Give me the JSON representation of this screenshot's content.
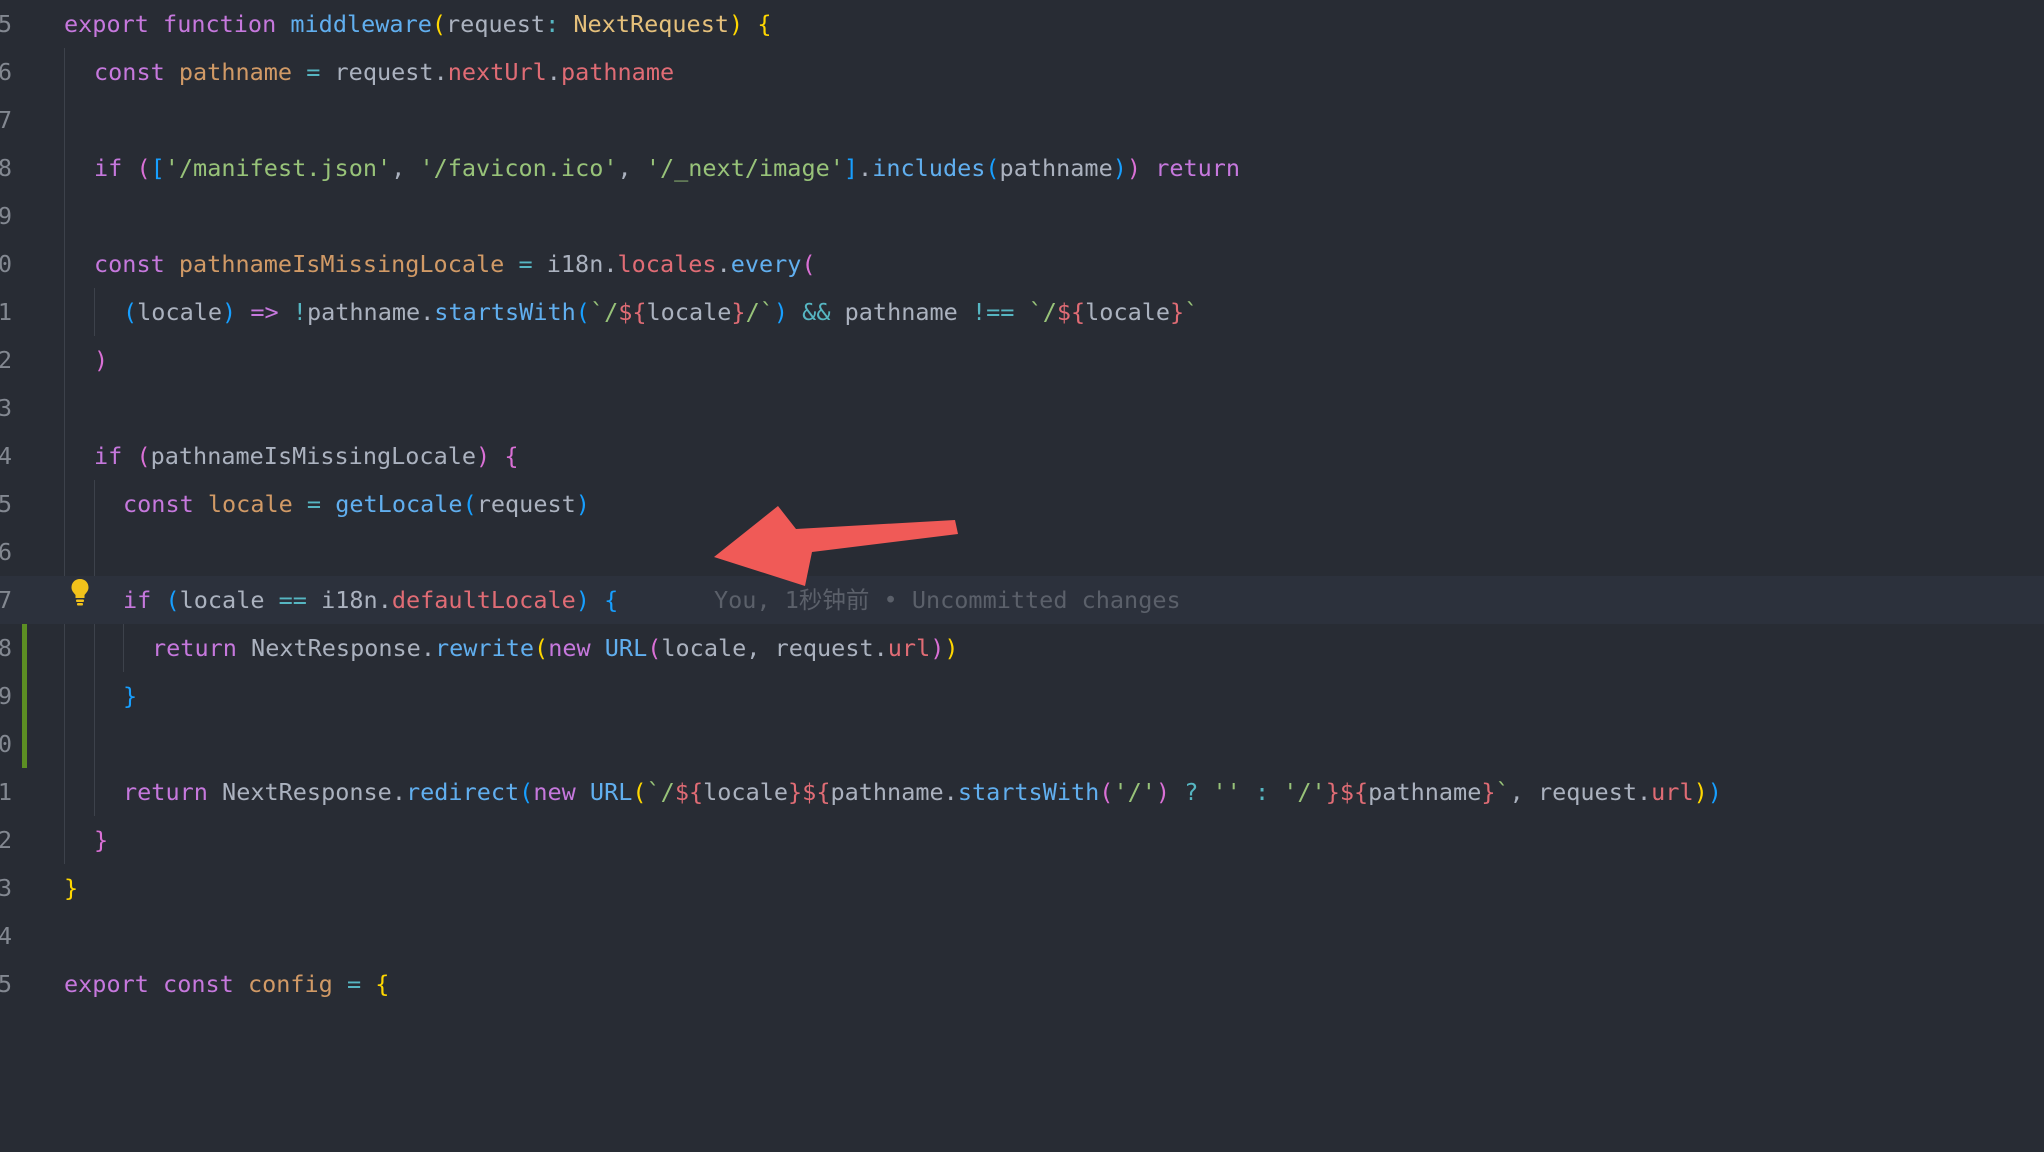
{
  "editor": {
    "line_numbers": [
      "5",
      "6",
      "7",
      "8",
      "9",
      "0",
      "1",
      "2",
      "3",
      "4",
      "5",
      "6",
      "7",
      "8",
      "9",
      "0",
      "1",
      "2",
      "3",
      "4",
      "5"
    ],
    "blame_annotation": "You, 1秒钟前 • Uncommitted changes",
    "colors": {
      "background": "#282c34",
      "keyword": "#c678dd",
      "function": "#61afef",
      "type": "#e5c07b",
      "variable": "#e06c75",
      "string": "#98c379",
      "modified_gutter": "#5c8f23",
      "arrow": "#f05a57"
    }
  },
  "code": {
    "l5": [
      "export ",
      "function ",
      "middleware",
      "(",
      "request",
      ": ",
      "NextRequest",
      ") ",
      "{"
    ],
    "l6": [
      "const ",
      "pathname",
      " = ",
      "request",
      ".",
      "nextUrl",
      ".",
      "pathname"
    ],
    "l8": [
      "if ",
      "(",
      "[",
      "'/manifest.json'",
      ", ",
      "'/favicon.ico'",
      ", ",
      "'/_next/image'",
      "]",
      ".",
      "includes",
      "(",
      "pathname",
      ")",
      ")",
      " return"
    ],
    "l10": [
      "const ",
      "pathnameIsMissingLocale",
      " = ",
      "i18n",
      ".",
      "locales",
      ".",
      "every",
      "("
    ],
    "l11": [
      "(",
      "locale",
      ")",
      " => ",
      "!",
      "pathname",
      ".",
      "startsWith",
      "(",
      "`/",
      "${",
      "locale",
      "}",
      "/`",
      ")",
      " && ",
      "pathname",
      " !== ",
      "`/",
      "${",
      "locale",
      "}",
      "`"
    ],
    "l12": [
      ")"
    ],
    "l14": [
      "if ",
      "(",
      "pathnameIsMissingLocale",
      ") ",
      "{"
    ],
    "l15": [
      "const ",
      "locale",
      " = ",
      "getLocale",
      "(",
      "request",
      ")"
    ],
    "l17": [
      "if ",
      "(",
      "locale",
      " == ",
      "i18n",
      ".",
      "defaultLocale",
      ") ",
      "{"
    ],
    "l18": [
      "return ",
      "NextResponse",
      ".",
      "rewrite",
      "(",
      "new ",
      "URL",
      "(",
      "locale",
      ", ",
      "request",
      ".",
      "url",
      ")",
      ")"
    ],
    "l19": [
      "}"
    ],
    "l21": [
      "return ",
      "NextResponse",
      ".",
      "redirect",
      "(",
      "new ",
      "URL",
      "(",
      "`/",
      "${",
      "locale",
      "}",
      "${",
      "pathname",
      ".",
      "startsWith",
      "(",
      "'/'",
      ") ",
      "? ",
      "'' ",
      ": ",
      "'/'",
      "}",
      "${",
      "pathname",
      "}",
      "`",
      ", ",
      "request",
      ".",
      "url",
      ")",
      ")"
    ],
    "l22": [
      "}"
    ],
    "l23": [
      "}"
    ],
    "l25": [
      "export ",
      "const ",
      "config",
      " = ",
      "{"
    ]
  }
}
